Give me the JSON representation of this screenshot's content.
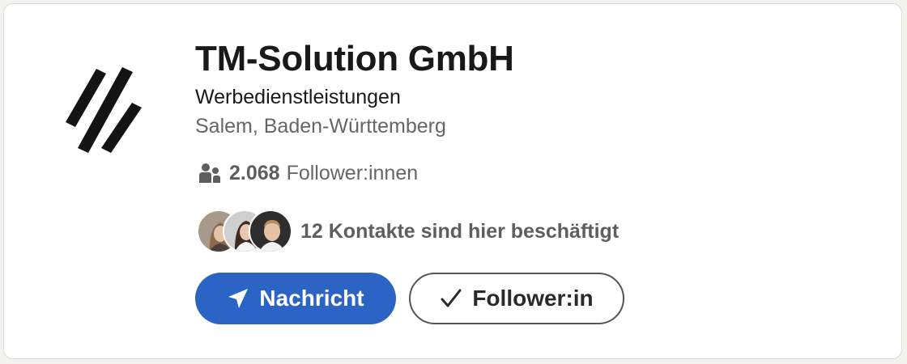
{
  "company": {
    "name": "TM-Solution GmbH",
    "industry": "Werbedienstleistungen",
    "location": "Salem, Baden-Württemberg",
    "logo_icon": "slash-stripes-logo"
  },
  "followers": {
    "icon": "people-icon",
    "count": "2.068",
    "label": "Follower:innen"
  },
  "connections": {
    "avatars": [
      "avatar-1",
      "avatar-2",
      "avatar-3"
    ],
    "text": "12 Kontakte sind hier beschäftigt"
  },
  "actions": {
    "message_label": "Nachricht",
    "message_icon": "send-icon",
    "follow_label": "Follower:in",
    "follow_icon": "check-icon"
  },
  "colors": {
    "primary_button": "#2b64c4",
    "muted_text": "#666666",
    "card_border": "#d9d9d9"
  }
}
